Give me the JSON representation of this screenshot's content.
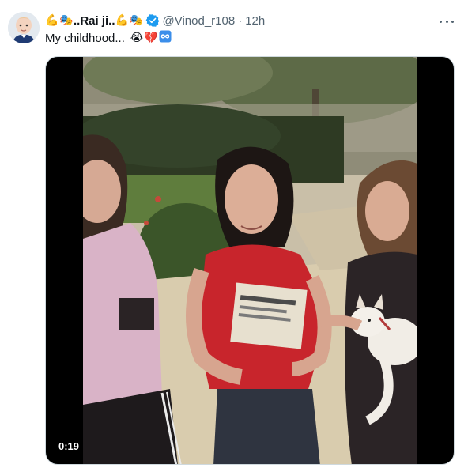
{
  "author": {
    "display_name": "..Rai ji..",
    "handle": "@Vinod_r108",
    "separator": "·",
    "time": "12h",
    "name_emojis": [
      "flexed-biceps",
      "performing-arts",
      "flexed-biceps",
      "performing-arts"
    ]
  },
  "tweet": {
    "text": "My childhood...",
    "text_emojis": [
      "loudly-crying-face",
      "broken-heart",
      "infinity"
    ]
  },
  "media": {
    "type": "video",
    "duration": "0:19"
  },
  "colors": {
    "text_primary": "#0f1419",
    "text_secondary": "#536471",
    "verified_blue": "#1d9bf0",
    "border": "#cfd9de"
  }
}
